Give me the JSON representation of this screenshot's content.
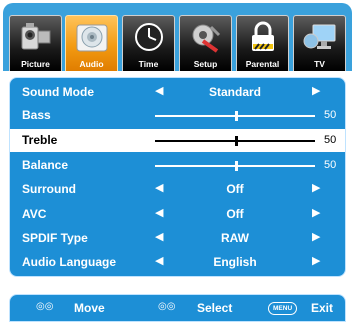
{
  "tabs": [
    {
      "label": "Picture",
      "icon": "picture-icon",
      "active": false
    },
    {
      "label": "Audio",
      "icon": "audio-icon",
      "active": true
    },
    {
      "label": "Time",
      "icon": "clock-icon",
      "active": false
    },
    {
      "label": "Setup",
      "icon": "wrench-icon",
      "active": false
    },
    {
      "label": "Parental",
      "icon": "lock-icon",
      "active": false
    },
    {
      "label": "TV",
      "icon": "tv-icon",
      "active": false
    }
  ],
  "menu": {
    "items": [
      {
        "label": "Sound Mode",
        "type": "option",
        "value": "Standard"
      },
      {
        "label": "Bass",
        "type": "slider",
        "value": "50",
        "level": 0.5
      },
      {
        "label": "Treble",
        "type": "slider",
        "value": "50",
        "level": 0.5,
        "selected": true
      },
      {
        "label": "Balance",
        "type": "slider",
        "value": "50",
        "level": 0.5
      },
      {
        "label": "Surround",
        "type": "option",
        "value": "Off"
      },
      {
        "label": "AVC",
        "type": "option",
        "value": "Off"
      },
      {
        "label": "SPDIF Type",
        "type": "option",
        "value": "RAW"
      },
      {
        "label": "Audio Language",
        "type": "option",
        "value": "English"
      }
    ],
    "left_arrow": "◀",
    "right_arrow": "▶"
  },
  "footer": {
    "move_icon": "◎◎",
    "move_label": "Move",
    "select_icon": "◎◎",
    "select_label": "Select",
    "menu_key": "MENU",
    "exit_label": "Exit"
  },
  "colors": {
    "tab_bar": "#3aa1dc",
    "panel": "#1d8fd6",
    "active_tab": "#f39b12"
  }
}
